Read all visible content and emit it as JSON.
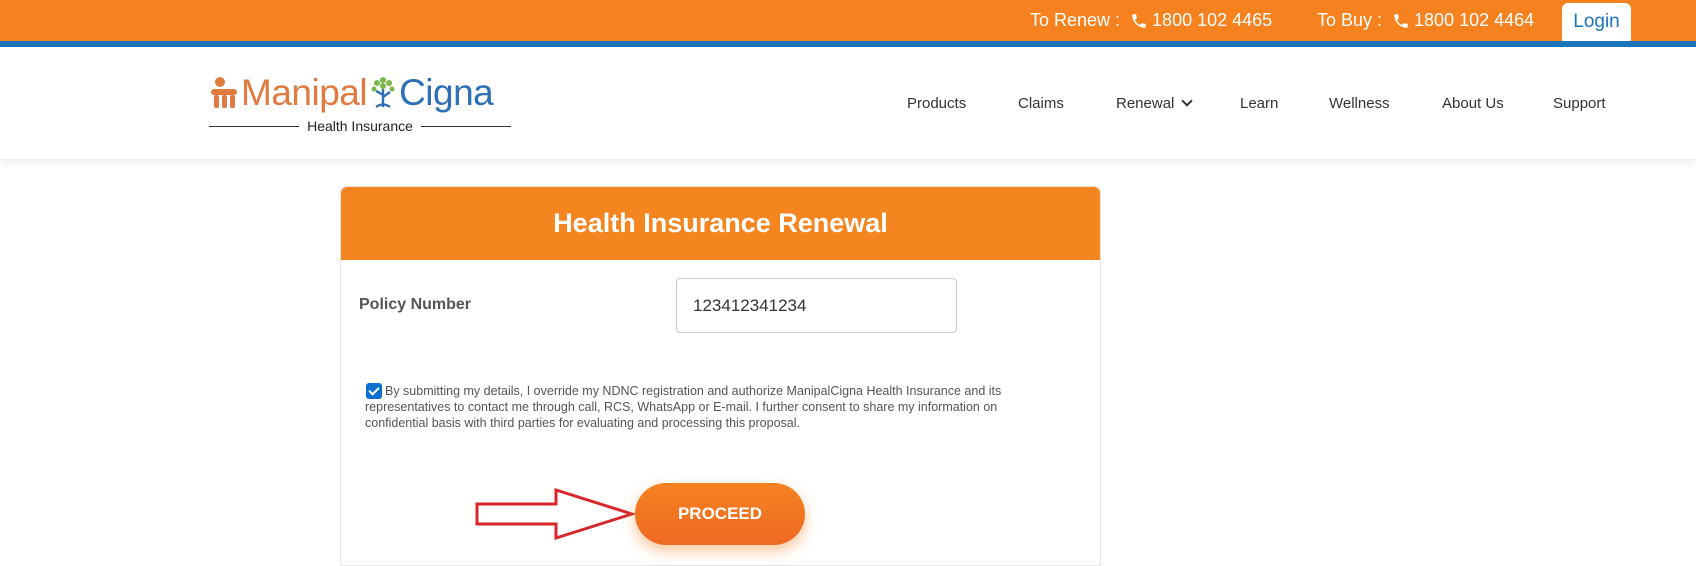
{
  "topbar": {
    "renew_label": "To Renew :",
    "renew_phone": "1800 102 4465",
    "buy_label": "To Buy :",
    "buy_phone": "1800 102 4464",
    "login_label": "Login"
  },
  "logo": {
    "brand_part1": "Manipal",
    "brand_part2": "Cigna",
    "subtitle": "Health Insurance"
  },
  "nav": {
    "items": [
      "Products",
      "Claims",
      "Renewal",
      "Learn",
      "Wellness",
      "About Us",
      "Support"
    ]
  },
  "form": {
    "title": "Health Insurance Renewal",
    "policy_label": "Policy Number",
    "policy_value": "123412341234",
    "consent_checked": true,
    "consent_text": "By submitting my details, I override my NDNC registration and authorize ManipalCigna Health Insurance and its representatives to contact me through call, RCS, WhatsApp or E-mail. I further consent to share my information on confidential basis with third parties for evaluating and processing this proposal.",
    "proceed_label": "PROCEED"
  },
  "colors": {
    "topbar_orange": "#f5821f",
    "stripe_blue": "#1b75bb",
    "card_header": "#f5851f",
    "arrow_red": "#d9262b"
  }
}
